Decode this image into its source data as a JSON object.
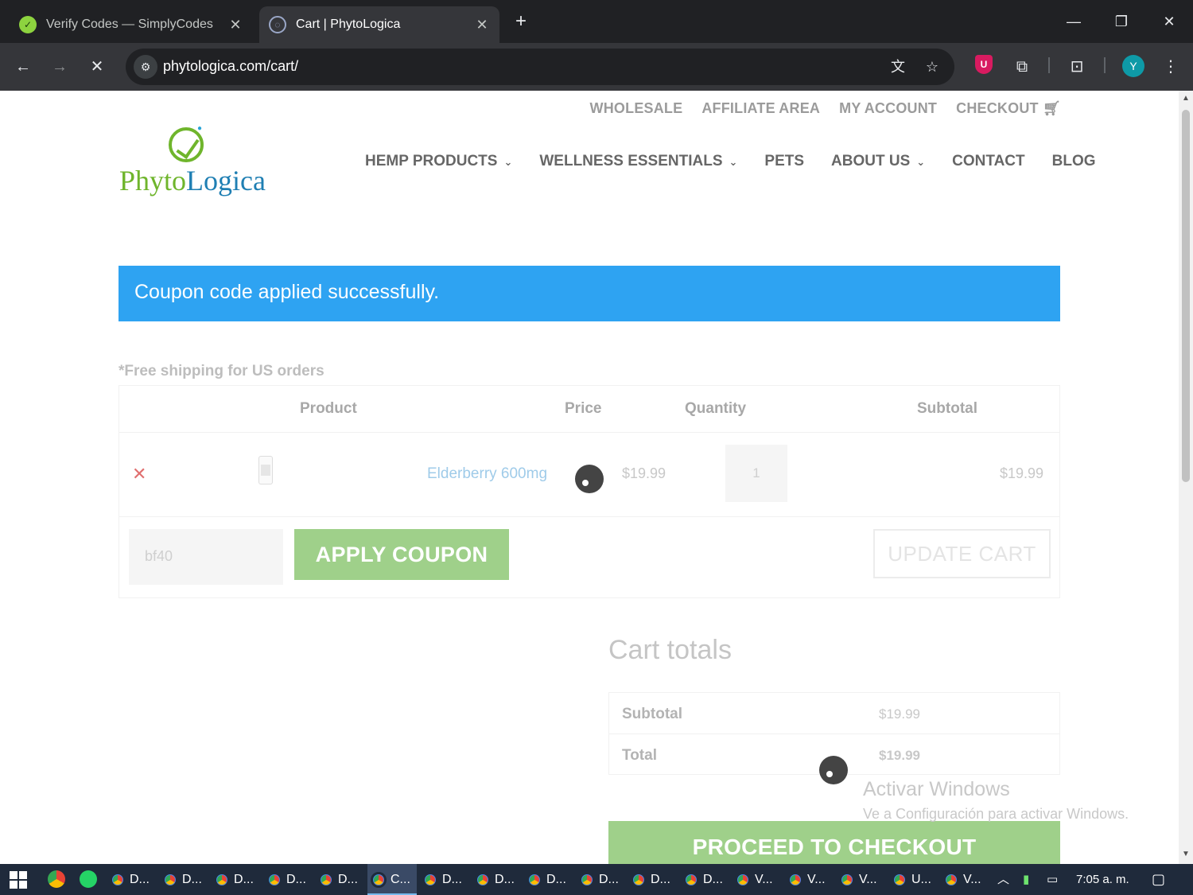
{
  "browser": {
    "tabs": [
      {
        "title": "Verify Codes — SimplyCodes",
        "active": false,
        "icon": "simplycodes-favicon"
      },
      {
        "title": "Cart | PhytoLogica",
        "active": true,
        "icon": "loading-spinner-favicon"
      }
    ],
    "url": "phytologica.com/cart/",
    "profile_initial": "Y",
    "extension_badge": "U"
  },
  "site": {
    "logo_text_1": "Phyto",
    "logo_text_2": "Logica",
    "top_nav": [
      "WHOLESALE",
      "AFFILIATE AREA",
      "MY ACCOUNT",
      "CHECKOUT"
    ],
    "main_nav": [
      {
        "label": "HEMP PRODUCTS",
        "dropdown": true
      },
      {
        "label": "WELLNESS ESSENTIALS",
        "dropdown": true
      },
      {
        "label": "PETS",
        "dropdown": false
      },
      {
        "label": "ABOUT US",
        "dropdown": true
      },
      {
        "label": "CONTACT",
        "dropdown": false
      },
      {
        "label": "BLOG",
        "dropdown": false
      }
    ]
  },
  "cart": {
    "notice": "Coupon code applied successfully.",
    "free_shipping": "*Free shipping for US orders",
    "headers": {
      "product": "Product",
      "price": "Price",
      "quantity": "Quantity",
      "subtotal": "Subtotal"
    },
    "items": [
      {
        "name": "Elderberry 600mg",
        "price": "$19.99",
        "quantity": "1",
        "subtotal": "$19.99"
      }
    ],
    "coupon_value": "bf40",
    "apply_coupon_label": "APPLY COUPON",
    "update_cart_label": "UPDATE CART"
  },
  "totals": {
    "title": "Cart totals",
    "subtotal_label": "Subtotal",
    "subtotal_value": "$19.99",
    "total_label": "Total",
    "total_value": "$19.99",
    "checkout_label": "PROCEED TO CHECKOUT"
  },
  "watermark": {
    "line1": "Activar Windows",
    "line2": "Ve a Configuración para activar Windows."
  },
  "taskbar": {
    "apps": [
      {
        "label": "D...",
        "active": false
      },
      {
        "label": "D...",
        "active": false
      },
      {
        "label": "D...",
        "active": false
      },
      {
        "label": "D...",
        "active": false
      },
      {
        "label": "D...",
        "active": false
      },
      {
        "label": "C...",
        "active": true
      },
      {
        "label": "D...",
        "active": false
      },
      {
        "label": "D...",
        "active": false
      },
      {
        "label": "D...",
        "active": false
      },
      {
        "label": "D...",
        "active": false
      },
      {
        "label": "D...",
        "active": false
      },
      {
        "label": "D...",
        "active": false
      },
      {
        "label": "V...",
        "active": false
      },
      {
        "label": "V...",
        "active": false
      },
      {
        "label": "V...",
        "active": false
      },
      {
        "label": "U...",
        "active": false
      },
      {
        "label": "V...",
        "active": false
      }
    ],
    "clock": "7:05 a. m."
  },
  "colors": {
    "notice_bg": "#2ea3f2",
    "button_green": "#9fd08a",
    "link_blue": "#9fcbe9",
    "remove_red": "#e06f6f"
  }
}
